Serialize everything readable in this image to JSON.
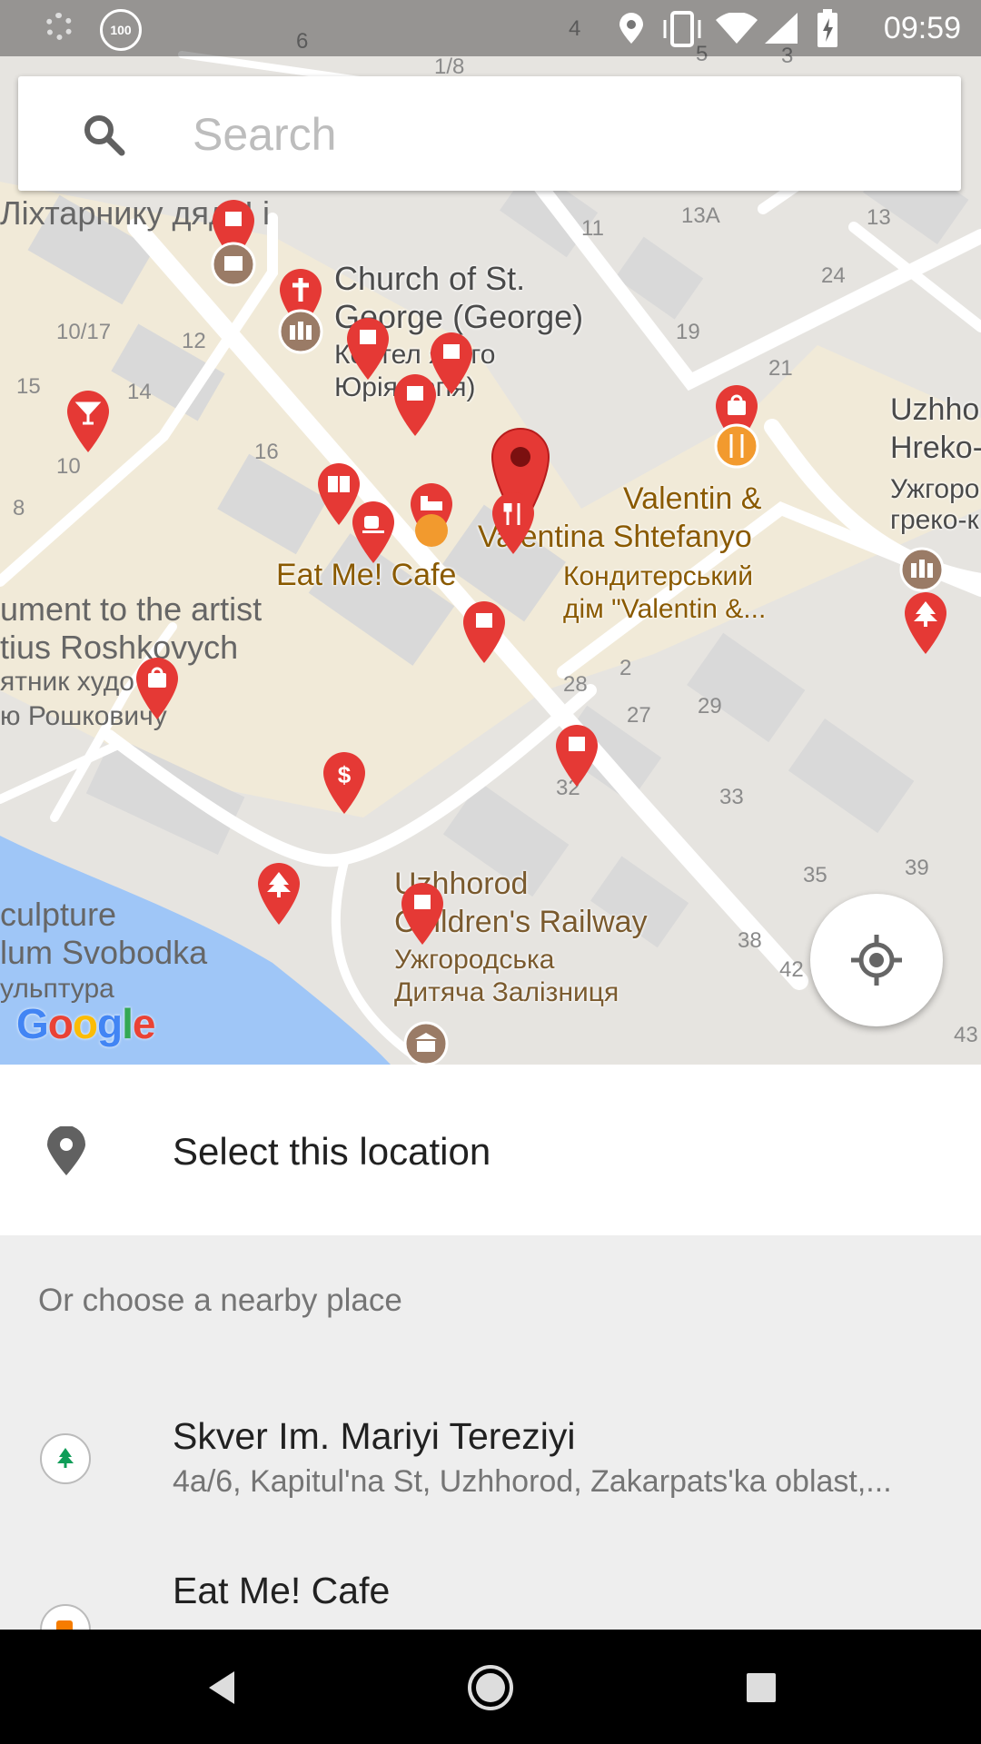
{
  "status_bar": {
    "battery_percent": "100",
    "time": "09:59",
    "icons": [
      "loading-icon",
      "battery-saver-icon",
      "location-icon",
      "vibrate-icon",
      "wifi-icon",
      "signal-icon",
      "battery-charging-icon"
    ]
  },
  "search": {
    "placeholder": "Search"
  },
  "map": {
    "street_labels": {
      "top_left": "Ліхтарнику дяді І  і",
      "monument_en_1": "ument to the artist",
      "monument_en_2": "tius Roshkovych",
      "monument_uk_1": "ятник худо    іку",
      "monument_uk_2": "ю Рошковичу",
      "sculpture_1": "culpture",
      "sculpture_2": "lum Svobodka",
      "sculpture_3": "ульптура"
    },
    "poi_labels": {
      "church_en_1": "Church of St.",
      "church_en_2": "George (George)",
      "church_uk_1": "Костел   ятого",
      "church_uk_2": "Юрія   оргія)",
      "eatme": "Eat Me! Cafe",
      "valentin_1": "Valentin &",
      "valentin_2": "Valentina Shtefanyo",
      "valentin_uk_1": "Кондитерський",
      "valentin_uk_2": "дім \"Valentin &...",
      "railway_1": "Uzhhorod",
      "railway_2": "Children's Railway",
      "railway_uk_1": "Ужгородська",
      "railway_uk_2": "Дитяча Залізниця",
      "uzh_1": "Uzhho",
      "uzh_2": "Hreko-",
      "uzh_uk_1": "Ужгоро",
      "uzh_uk_2": "греко-к"
    },
    "house_numbers": [
      "6",
      "1/8",
      "4",
      "5",
      "3",
      "11",
      "13А",
      "13",
      "24",
      "10/17",
      "12",
      "19",
      "21",
      "15",
      "14",
      "10",
      "16",
      "8",
      "2",
      "28",
      "27",
      "29",
      "32",
      "33",
      "35",
      "39",
      "38",
      "42",
      "43"
    ],
    "logo": "Google"
  },
  "select_location": {
    "label": "Select this location"
  },
  "nearby": {
    "header": "Or choose a nearby place",
    "places": [
      {
        "name": "Skver Im. Mariyi Tereziyi",
        "address": "4a/6, Kapitul'na St, Uzhhorod, Zakarpats'ka oblast,...",
        "icon": "park-icon",
        "icon_color": "#0f9d58"
      },
      {
        "name": "Eat Me! Cafe",
        "address": "",
        "icon": "cafe-icon",
        "icon_color": "#f57c00"
      }
    ]
  },
  "colors": {
    "pin_red": "#e53935",
    "poi_orange": "#f29a2e",
    "water": "#9fc6f7",
    "road": "#ffffff"
  }
}
